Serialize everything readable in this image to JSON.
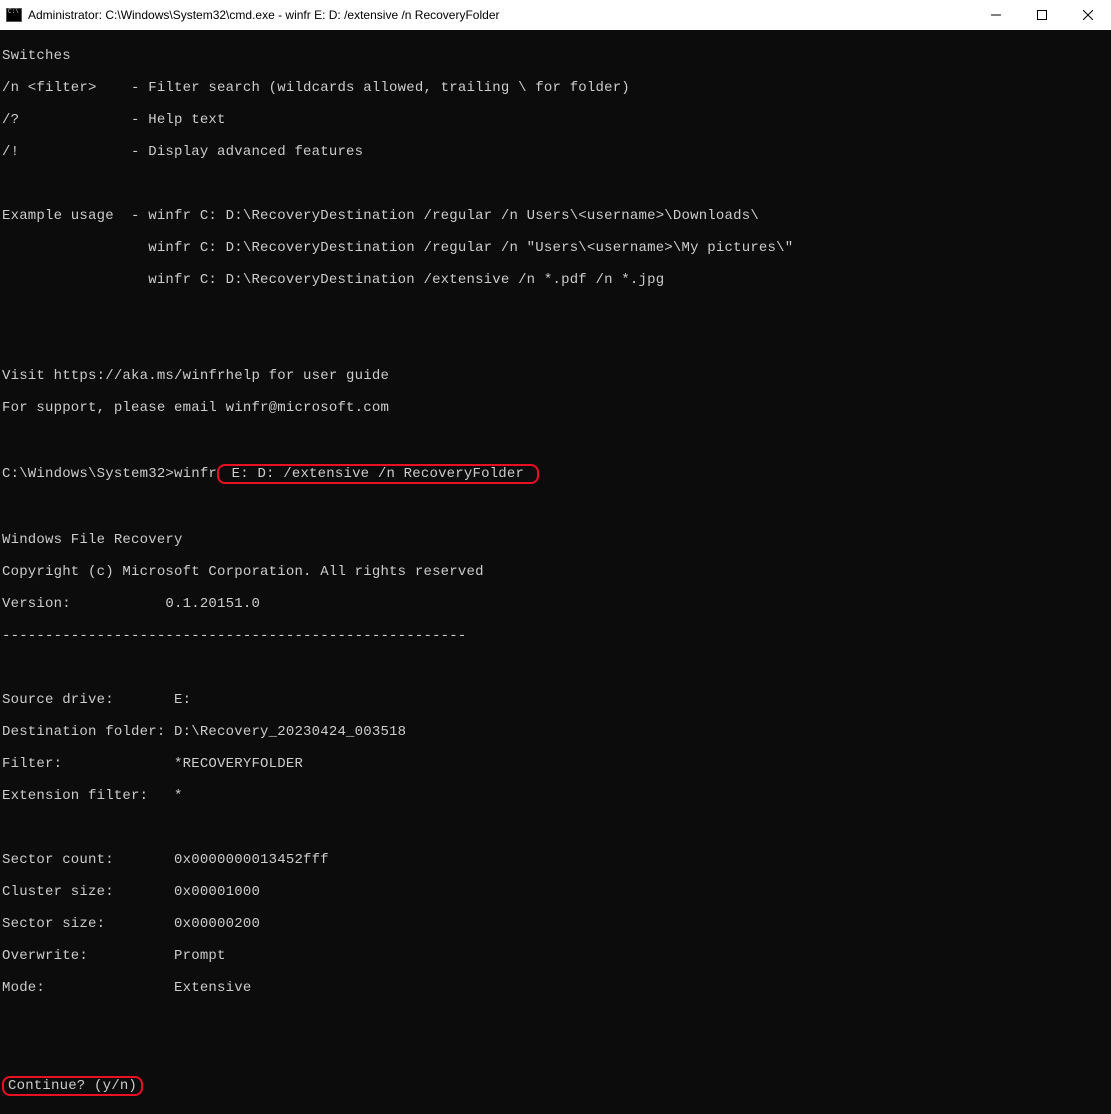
{
  "titlebar": {
    "title": "Administrator: C:\\Windows\\System32\\cmd.exe - winfr  E: D: /extensive /n RecoveryFolder"
  },
  "terminal": {
    "switches_header": "Switches",
    "switch_n": "/n <filter>    - Filter search (wildcards allowed, trailing \\ for folder)",
    "switch_help": "/?             - Help text",
    "switch_advanced": "/!             - Display advanced features",
    "blank": "",
    "example_header": "Example usage  - winfr C: D:\\RecoveryDestination /regular /n Users\\<username>\\Downloads\\",
    "example_2": "                 winfr C: D:\\RecoveryDestination /regular /n \"Users\\<username>\\My pictures\\\"",
    "example_3": "                 winfr C: D:\\RecoveryDestination /extensive /n *.pdf /n *.jpg",
    "help_url": "Visit https://aka.ms/winfrhelp for user guide",
    "support_email": "For support, please email winfr@microsoft.com",
    "prompt_prefix": "C:\\Windows\\System32>winfr",
    "highlighted_cmd": " E: D: /extensive /n RecoveryFolder ",
    "app_name": "Windows File Recovery",
    "copyright": "Copyright (c) Microsoft Corporation. All rights reserved",
    "version_label": "Version:           0.1.20151.0",
    "divider": "------------------------------------------------------",
    "source_drive": "Source drive:       E:",
    "dest_folder": "Destination folder: D:\\Recovery_20230424_003518",
    "filter": "Filter:             *RECOVERYFOLDER",
    "ext_filter": "Extension filter:   *",
    "sector_count": "Sector count:       0x0000000013452fff",
    "cluster_size": "Cluster size:       0x00001000",
    "sector_size": "Sector size:        0x00000200",
    "overwrite": "Overwrite:          Prompt",
    "mode": "Mode:               Extensive",
    "continue_prompt": "Continue? (y/n)"
  }
}
